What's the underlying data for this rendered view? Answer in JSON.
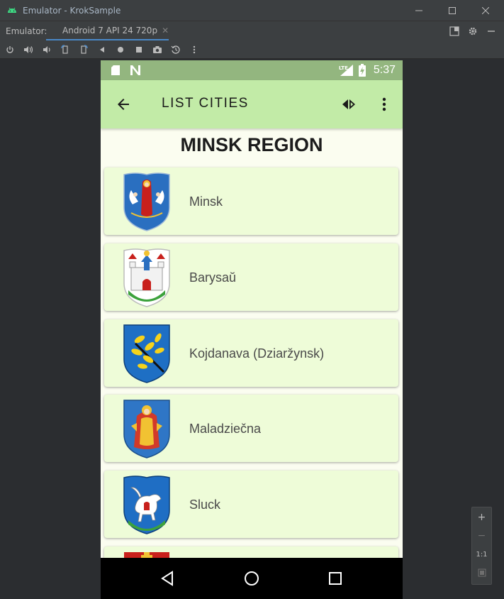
{
  "window": {
    "title": "Emulator - KrokSample"
  },
  "tabbar": {
    "label": "Emulator:",
    "tab_label": "Android 7 API 24 720p",
    "close_glyph": "✕"
  },
  "toolbar": {
    "icons": [
      "power-icon",
      "volume-up-icon",
      "volume-down-icon",
      "rotate-left-icon",
      "rotate-right-icon",
      "back-icon",
      "home-icon",
      "overview-icon",
      "screenshot-icon",
      "snapshot-icon",
      "more-icon"
    ]
  },
  "phone": {
    "status": {
      "time": "5:37",
      "network": "LTE"
    },
    "appbar": {
      "title": "LIST CITIES"
    },
    "region_title": "MINSK REGION",
    "cities": [
      {
        "name": "Minsk"
      },
      {
        "name": "Barysaŭ"
      },
      {
        "name": "Kojdanava (Dziaržynsk)"
      },
      {
        "name": "Maladziečna"
      },
      {
        "name": "Sluck"
      }
    ]
  },
  "zoom": {
    "plus": "+",
    "minus": "−",
    "one_to_one": "1:1"
  },
  "colors": {
    "status_bar": "#93b67f",
    "app_bar": "#c2eba7",
    "card": "#eefcd8",
    "background": "#fbfdf0",
    "ide_chrome": "#3c3f41",
    "tab_accent": "#4a88c7"
  }
}
